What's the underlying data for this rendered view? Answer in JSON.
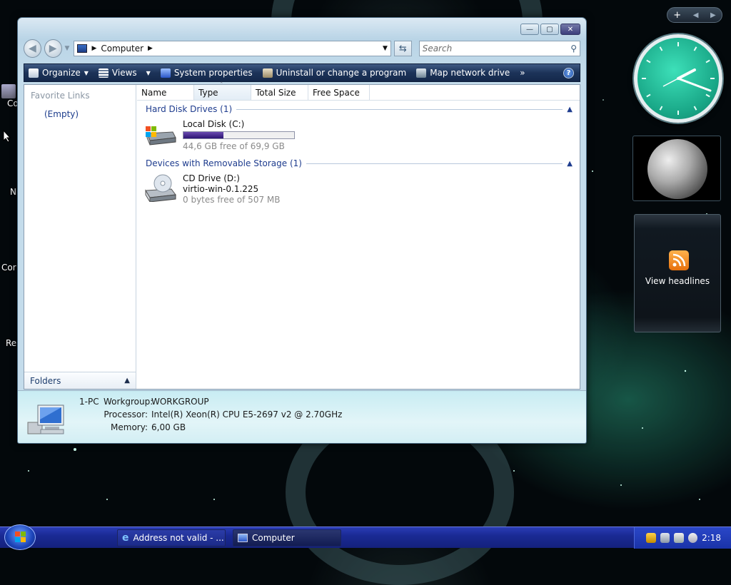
{
  "desktop": {
    "icon_labels": [
      "Co",
      "N",
      "Cor",
      "Re"
    ]
  },
  "window": {
    "address": {
      "location": "Computer"
    },
    "search": {
      "placeholder": "Search"
    },
    "toolbar": {
      "organize": "Organize",
      "views": "Views",
      "system_properties": "System properties",
      "uninstall": "Uninstall or change a program",
      "map_drive": "Map network drive",
      "more": "»",
      "help": "?"
    },
    "navpane": {
      "favorite_links": "Favorite Links",
      "empty": "(Empty)",
      "folders": "Folders"
    },
    "columns": [
      "Name",
      "Type",
      "Total Size",
      "Free Space"
    ],
    "groups": [
      {
        "title": "Hard Disk Drives (1)",
        "drives": [
          {
            "name": "Local Disk (C:)",
            "free_text": "44,6 GB free of 69,9 GB",
            "used_fraction": 0.362
          }
        ]
      },
      {
        "title": "Devices with Removable Storage (1)",
        "drives": [
          {
            "name": "CD Drive (D:)",
            "label": "virtio-win-0.1.225",
            "free_text": "0 bytes free of 507 MB"
          }
        ]
      }
    ],
    "details": {
      "pc_name": "1-PC",
      "workgroup_label": "Workgroup:",
      "workgroup_value": "WORKGROUP",
      "processor_label": "Processor:",
      "processor_value": "Intel(R) Xeon(R) CPU E5-2697 v2 @ 2.70GHz",
      "memory_label": "Memory:",
      "memory_value": "6,00 GB"
    }
  },
  "gadgets": {
    "feeds_label": "View headlines"
  },
  "taskbar": {
    "tasks": [
      {
        "label": "Address not valid - ..."
      },
      {
        "label": "Computer"
      }
    ],
    "time": "2:18"
  },
  "colors": {
    "toolbar": "#1c3359",
    "accent_link": "#1e3c8e",
    "taskbar": "#1a2a94",
    "clock_face": "#19a787"
  }
}
